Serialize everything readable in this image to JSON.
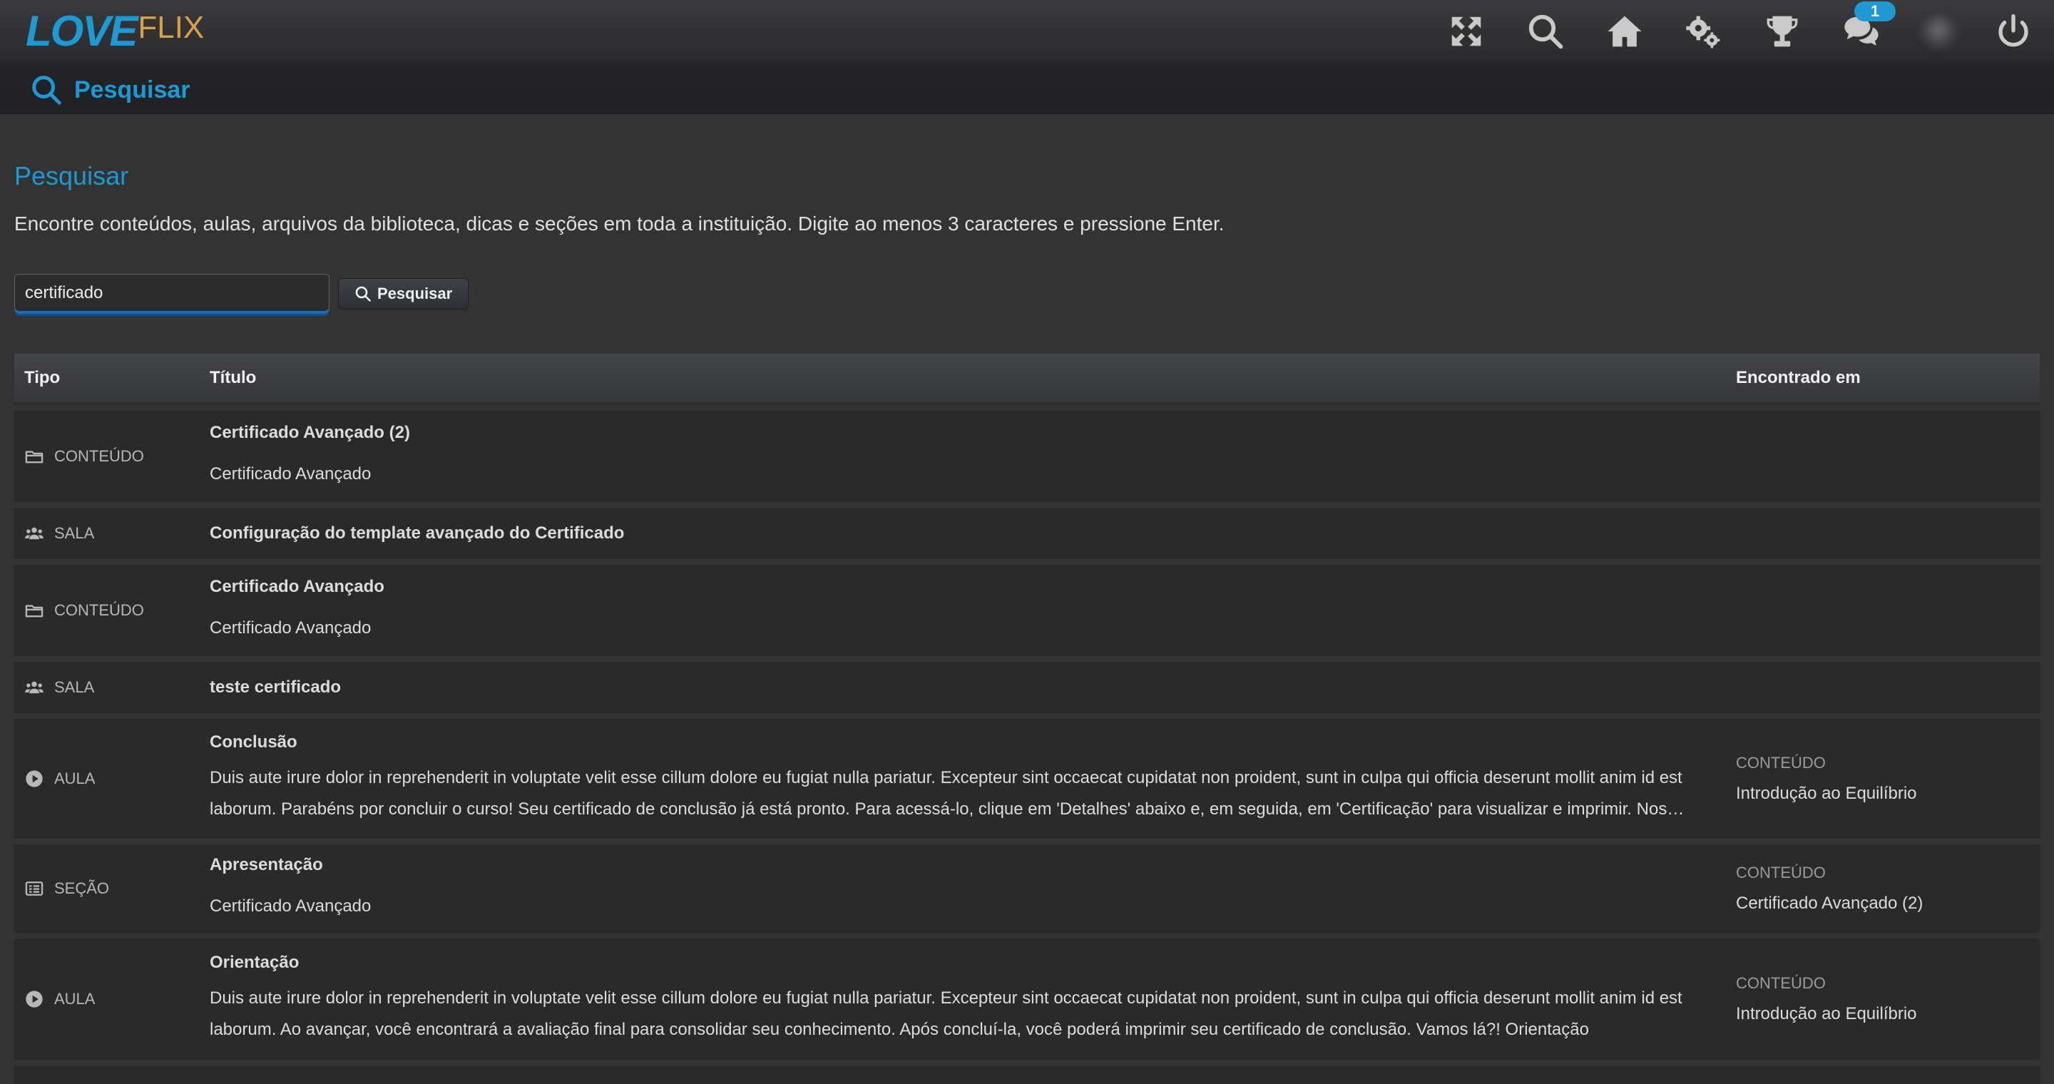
{
  "app": {
    "logo_love": "LOVE",
    "logo_flix": "FLIX",
    "notification_count": "1",
    "accent_color": "#1b9ad6"
  },
  "header": {
    "icons": [
      "fullscreen-icon",
      "search-icon",
      "home-icon",
      "settings-icon",
      "trophy-icon",
      "chat-icon",
      "avatar",
      "power-icon"
    ],
    "page_title": "Pesquisar"
  },
  "main": {
    "title": "Pesquisar",
    "description": "Encontre conteúdos, aulas, arquivos da biblioteca, dicas e seções em toda a instituição. Digite ao menos 3 caracteres e pressione Enter.",
    "search": {
      "value": "certificado",
      "button_label": "Pesquisar"
    },
    "table": {
      "columns": [
        "Tipo",
        "Título",
        "Encontrado em"
      ],
      "rows": [
        {
          "icon": "folder-icon",
          "type": "CONTEÚDO",
          "title": "Certificado Avançado (2)",
          "subtitle": "Certificado Avançado",
          "found_type": "",
          "found_name": ""
        },
        {
          "icon": "users-icon",
          "type": "SALA",
          "title": "Configuração do template avançado do Certificado",
          "subtitle": "",
          "found_type": "",
          "found_name": ""
        },
        {
          "icon": "folder-icon",
          "type": "CONTEÚDO",
          "title": "Certificado Avançado",
          "subtitle": "Certificado Avançado",
          "found_type": "",
          "found_name": ""
        },
        {
          "icon": "users-icon",
          "type": "SALA",
          "title": "teste certificado",
          "subtitle": "",
          "found_type": "",
          "found_name": ""
        },
        {
          "icon": "play-icon",
          "type": "AULA",
          "title": "Conclusão",
          "subtitle": "Duis aute irure dolor in reprehenderit in voluptate velit esse cillum dolore eu fugiat nulla pariatur. Excepteur sint occaecat cupidatat non proident, sunt in culpa qui officia deserunt mollit anim id est laborum. Parabéns por concluir o curso! Seu certificado de conclusão já está pronto. Para acessá-lo, clique em 'Detalhes' abaixo e, em seguida, em 'Certificação' para visualizar e imprimir. Nos próximos dias você receberá mais informações.",
          "found_type": "CONTEÚDO",
          "found_name": "Introdução ao Equilíbrio"
        },
        {
          "icon": "section-icon",
          "type": "SEÇÃO",
          "title": "Apresentação",
          "subtitle": "Certificado Avançado",
          "found_type": "CONTEÚDO",
          "found_name": "Certificado Avançado (2)"
        },
        {
          "icon": "play-icon",
          "type": "AULA",
          "title": "Orientação",
          "subtitle": "Duis aute irure dolor in reprehenderit in voluptate velit esse cillum dolore eu fugiat nulla pariatur. Excepteur sint occaecat cupidatat non proident, sunt in culpa qui officia deserunt mollit anim id est laborum. Ao avançar, você encontrará a avaliação final para consolidar seu conhecimento. Após concluí-la, você poderá imprimir seu certificado de conclusão. Vamos lá?! Orientação",
          "found_type": "CONTEÚDO",
          "found_name": "Introdução ao Equilíbrio"
        }
      ]
    }
  }
}
